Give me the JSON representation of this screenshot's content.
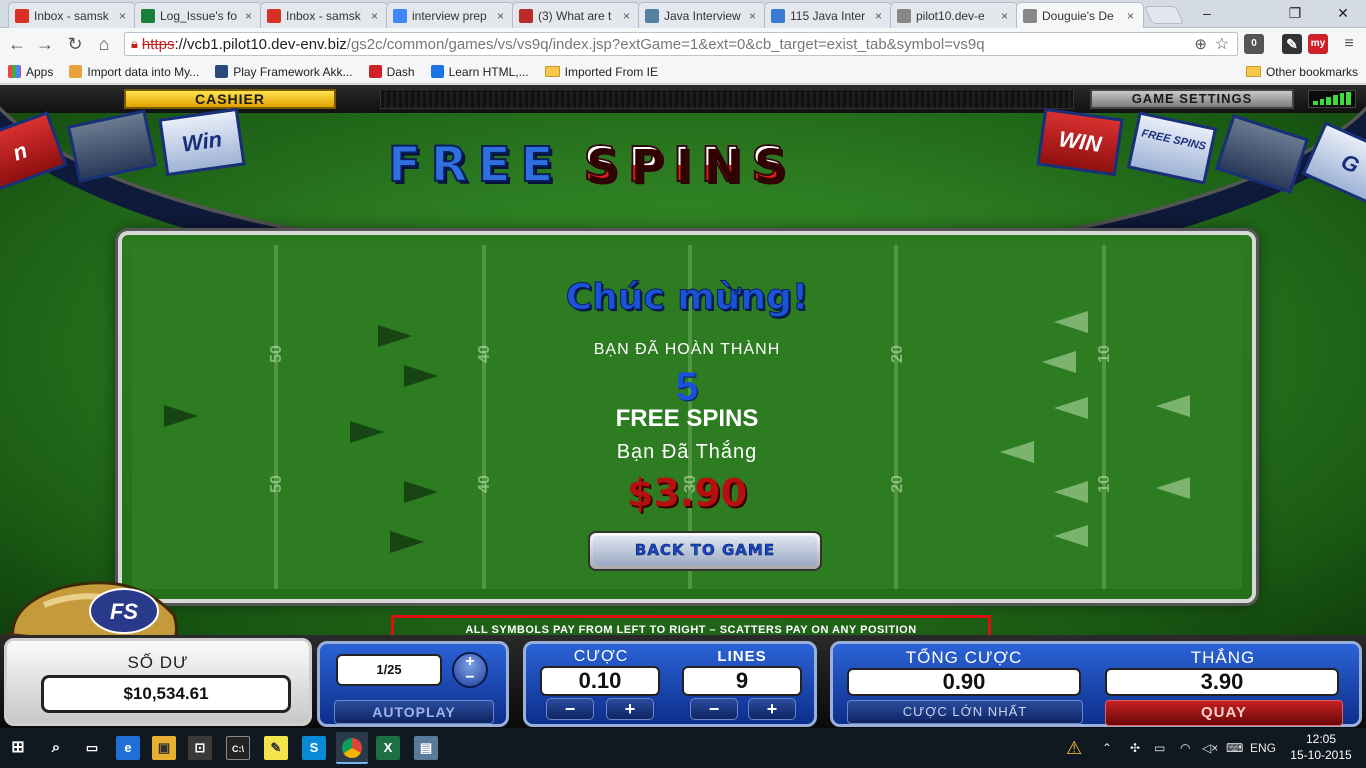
{
  "browser": {
    "tabs": [
      {
        "title": "Inbox - samsk",
        "icon": "gmail-icon",
        "color": "#d93025"
      },
      {
        "title": "Log_Issue's fo",
        "icon": "sheets-icon",
        "color": "#188038"
      },
      {
        "title": "Inbox - samsk",
        "icon": "gmail-icon",
        "color": "#d93025"
      },
      {
        "title": "interview prep",
        "icon": "google-icon",
        "color": "#4285f4"
      },
      {
        "title": "(3) What are t",
        "icon": "quora-icon",
        "color": "#b92b27"
      },
      {
        "title": "Java Interview",
        "icon": "java-icon",
        "color": "#5382a1"
      },
      {
        "title": "115 Java Inter",
        "icon": "star-icon",
        "color": "#3a7bd5"
      },
      {
        "title": "pilot10.dev-e",
        "icon": "page-icon",
        "color": "#888888"
      },
      {
        "title": "Douguie's De",
        "icon": "page-icon",
        "color": "#888888",
        "active": true
      }
    ],
    "url": {
      "scheme": "https",
      "host": "://vcb1.pilot10.dev-env.biz",
      "path": "/gs2c/common/games/vs/vs9q/index.jsp?extGame=1&ext=0&cb_target=exist_tab&symbol=vs9q"
    },
    "extensions": {
      "badge": "0",
      "my_label": "my"
    },
    "bookmarks": [
      {
        "label": "Apps",
        "type": "apps"
      },
      {
        "label": "Import data into My...",
        "type": "page"
      },
      {
        "label": "Play Framework Akk...",
        "type": "page"
      },
      {
        "label": "Dash",
        "type": "page"
      },
      {
        "label": "Learn HTML,...",
        "type": "page"
      },
      {
        "label": "Imported From IE",
        "type": "folder"
      }
    ],
    "other_bookmarks": "Other bookmarks"
  },
  "game": {
    "cashier": "CASHIER",
    "game_settings": "GAME SETTINGS",
    "title_word1": "FREE",
    "title_word2": "SPINS",
    "banners": [
      "Win",
      "WIN",
      "FREE SPINS"
    ],
    "popup": {
      "congrats": "Chúc mừng!",
      "completed": "BẠN ĐÃ HOÀN THÀNH",
      "spins_count": "5",
      "free_spins": "FREE SPINS",
      "you_won": "Bạn Đã Thắng",
      "win_amount": "$3.90",
      "back_button": "BACK TO GAME",
      "yard_numbers": [
        "50",
        "40",
        "30",
        "20",
        "10"
      ]
    },
    "helmet_logo": "FS",
    "rules_text": "ALL SYMBOLS PAY FROM LEFT TO RIGHT – SCATTERS PAY ON ANY POSITION",
    "stars": "★★★★★★★★★★★★★★★",
    "balance": {
      "label": "SỐ DƯ",
      "value": "$10,534.61"
    },
    "autoplay": {
      "count": "1/25",
      "label": "AUTOPLAY"
    },
    "bet": {
      "label": "CƯỢC",
      "value": "0.10"
    },
    "lines": {
      "label": "LINES",
      "value": "9"
    },
    "total_bet": {
      "label": "TỔNG CƯỢC",
      "value": "0.90",
      "max_bet_label": "CƯỢC LỚN NHẤT"
    },
    "win": {
      "label": "THẮNG",
      "value": "3.90",
      "spin_label": "QUAY"
    }
  },
  "taskbar": {
    "lang": "ENG",
    "time": "12:05",
    "date": "15-10-2015"
  },
  "colors": {
    "accent_blue": "#1a50e0",
    "win_red": "#b50f0f",
    "cashier_yellow": "#ffe44d",
    "rules_border": "#e01010"
  }
}
